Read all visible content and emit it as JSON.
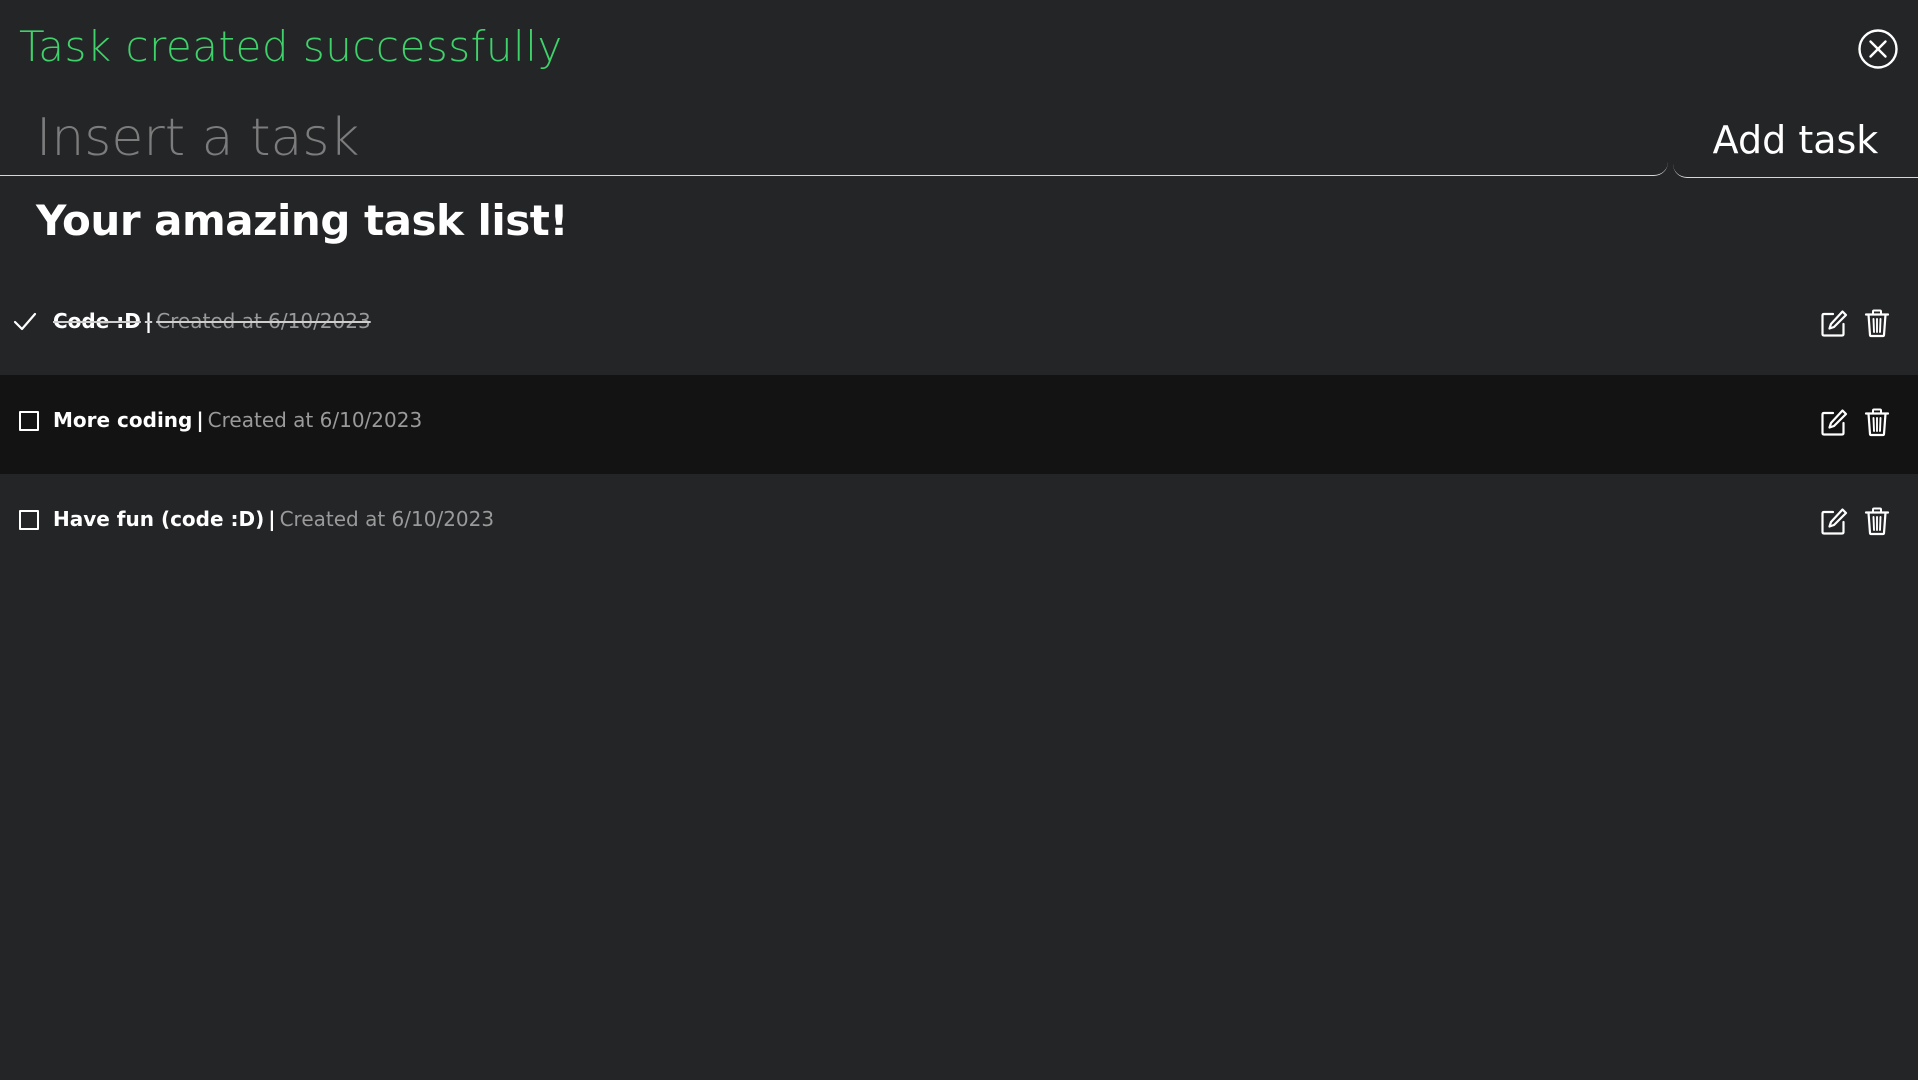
{
  "notification": {
    "message": "Task created successfully",
    "color": "#3fd16a",
    "close_icon": "close-circle-icon"
  },
  "form": {
    "input_value": "",
    "input_placeholder": "Insert a task",
    "submit_label": "Add task"
  },
  "list": {
    "heading": "Your amazing task list!",
    "separator": "|",
    "tasks": [
      {
        "title": "Code :D",
        "created": "Created at 6/10/2023",
        "completed": true,
        "check_icon": "checkmark-icon",
        "edit_icon": "edit-icon",
        "delete_icon": "trash-icon"
      },
      {
        "title": "More coding",
        "created": "Created at 6/10/2023",
        "completed": false,
        "check_icon": "checkbox-empty-icon",
        "edit_icon": "edit-icon",
        "delete_icon": "trash-icon"
      },
      {
        "title": "Have fun (code :D)",
        "created": "Created at 6/10/2023",
        "completed": false,
        "check_icon": "checkbox-empty-icon",
        "edit_icon": "edit-icon",
        "delete_icon": "trash-icon"
      }
    ]
  },
  "colors": {
    "background": "#242527",
    "row_highlight": "#131314",
    "success": "#3fd16a",
    "muted_text": "#9a9a9a"
  }
}
